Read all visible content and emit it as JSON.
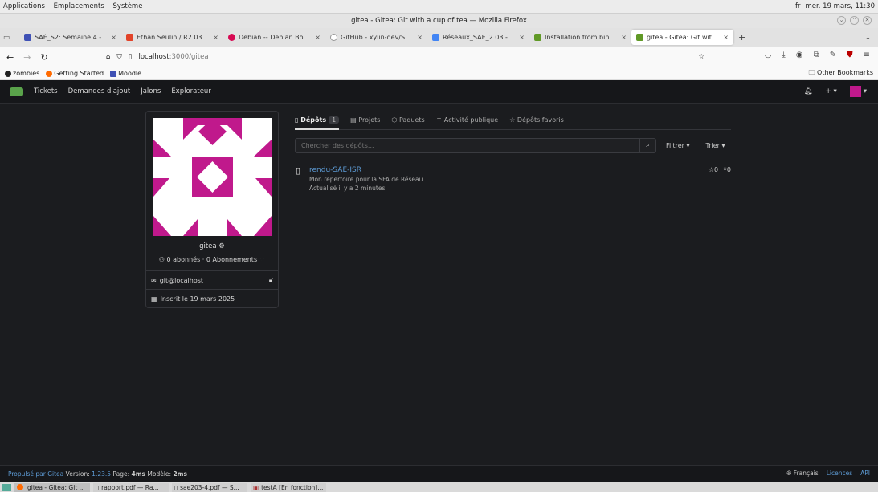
{
  "system": {
    "menus": [
      "Applications",
      "Emplacements",
      "Système"
    ],
    "lang": "fr",
    "clock": "mer. 19 mars, 11:30"
  },
  "window": {
    "title": "gitea - Gitea: Git with a cup of tea — Mozilla Firefox"
  },
  "tabs": [
    {
      "label": "SAÉ_S2: Semaine 4 - S10",
      "color": "#3f51b5"
    },
    {
      "label": "Ethan Seulin / R2.03 - Git",
      "color": "#e24329"
    },
    {
      "label": "Debian -- Debian Bookworm",
      "color": "#d70a53"
    },
    {
      "label": "GitHub - xylin-dev/S2.03",
      "color": "#ffffff"
    },
    {
      "label": "Réseaux_SAE_2.03 - Goo",
      "color": "#4285f4"
    },
    {
      "label": "Installation from binary",
      "color": "#609926"
    },
    {
      "label": "gitea - Gitea: Git with a cu",
      "color": "#609926",
      "active": true
    }
  ],
  "url": {
    "host": "localhost",
    "path": ":3000/gitea"
  },
  "bookmarks": [
    {
      "label": "zombies"
    },
    {
      "label": "Getting Started"
    },
    {
      "label": "Moodle"
    }
  ],
  "bookmarks_other": "Other Bookmarks",
  "gitea": {
    "nav": [
      "Tickets",
      "Demandes d'ajout",
      "Jalons",
      "Explorateur"
    ],
    "profile": {
      "name": "gitea",
      "follow": "0 abonnés · 0 Abonnements",
      "email": "git@localhost",
      "joined": "Inscrit le 19 mars 2025"
    },
    "tabs": {
      "repos": "Dépôts",
      "repos_count": "1",
      "projects": "Projets",
      "packages": "Paquets",
      "activity": "Activité publique",
      "starred": "Dépôts favoris"
    },
    "search_placeholder": "Chercher des dépôts...",
    "filter": "Filtrer",
    "sort": "Trier",
    "repo": {
      "name": "rendu-SAE-ISR",
      "description": "Mon repertoire pour la SFA de Réseau",
      "updated": "Actualisé il y a 2 minutes",
      "stars": "0",
      "forks": "0"
    },
    "footer": {
      "powered": "Propulsé par Gitea",
      "version_label": "Version:",
      "version": "1.23.5",
      "page_label": "Page:",
      "page": "4ms",
      "model_label": "Modèle:",
      "model": "2ms",
      "lang": "Français",
      "licences": "Licences",
      "api": "API"
    }
  },
  "taskbar": [
    "gitea - Gitea: Git ...",
    "rapport.pdf — Ra...",
    "sae203-4.pdf — S...",
    "testA [En fonction]..."
  ]
}
